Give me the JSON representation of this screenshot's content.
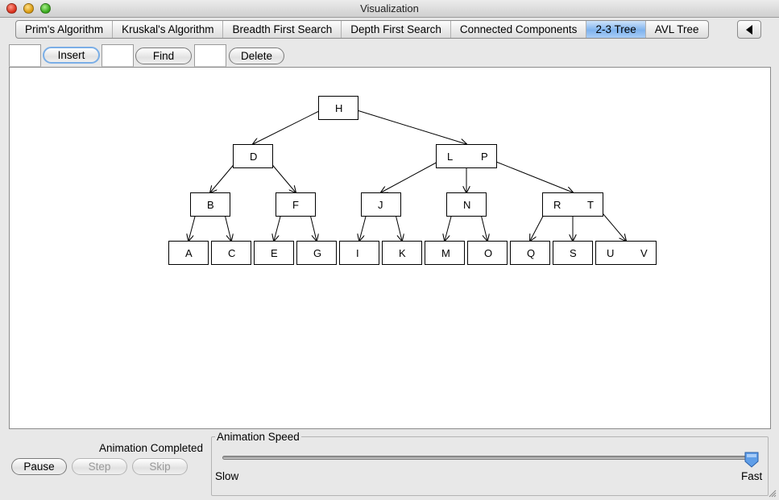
{
  "window": {
    "title": "Visualization"
  },
  "tabs": [
    {
      "label": "Prim's Algorithm",
      "active": false
    },
    {
      "label": "Kruskal's Algorithm",
      "active": false
    },
    {
      "label": "Breadth First Search",
      "active": false
    },
    {
      "label": "Depth First Search",
      "active": false
    },
    {
      "label": "Connected Components",
      "active": false
    },
    {
      "label": "2-3 Tree",
      "active": true
    },
    {
      "label": "AVL Tree",
      "active": false
    }
  ],
  "toolbar": {
    "insert_value": "",
    "insert_label": "Insert",
    "find_value": "",
    "find_label": "Find",
    "delete_value": "",
    "delete_label": "Delete"
  },
  "tree": {
    "nodes": [
      {
        "keys": [
          "H"
        ]
      },
      {
        "keys": [
          "D"
        ]
      },
      {
        "keys": [
          "L",
          "P"
        ]
      },
      {
        "keys": [
          "B"
        ]
      },
      {
        "keys": [
          "F"
        ]
      },
      {
        "keys": [
          "J"
        ]
      },
      {
        "keys": [
          "N"
        ]
      },
      {
        "keys": [
          "R",
          "T"
        ]
      },
      {
        "keys": [
          "A"
        ]
      },
      {
        "keys": [
          "C"
        ]
      },
      {
        "keys": [
          "E"
        ]
      },
      {
        "keys": [
          "G"
        ]
      },
      {
        "keys": [
          "I"
        ]
      },
      {
        "keys": [
          "K"
        ]
      },
      {
        "keys": [
          "M"
        ]
      },
      {
        "keys": [
          "O"
        ]
      },
      {
        "keys": [
          "Q"
        ]
      },
      {
        "keys": [
          "S"
        ]
      },
      {
        "keys": [
          "U",
          "V"
        ]
      }
    ]
  },
  "status": {
    "text": "Animation Completed"
  },
  "controls": {
    "pause_label": "Pause",
    "step_label": "Step",
    "skip_label": "Skip"
  },
  "speed": {
    "title": "Animation Speed",
    "min_label": "Slow",
    "max_label": "Fast",
    "value": 1.0
  },
  "colors": {
    "active_tab": "#7fb3ee",
    "focus_ring": "#7aaee6",
    "slider_thumb": "#5f9ee8"
  }
}
